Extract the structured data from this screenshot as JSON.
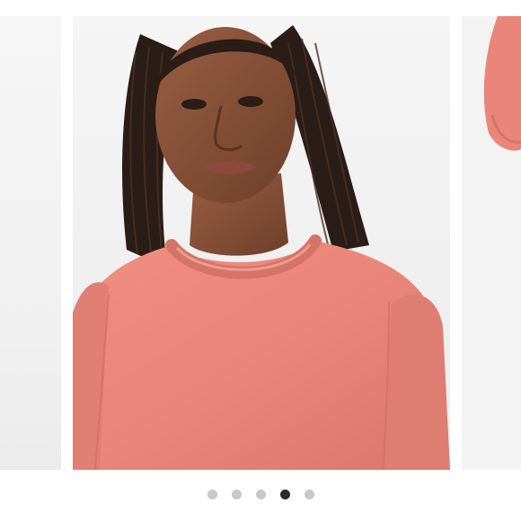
{
  "carousel": {
    "slide_count": 5,
    "active_index": 3,
    "slides": [
      {
        "state": "previous",
        "subject": "product-photo"
      },
      {
        "state": "current",
        "subject": "model-wearing-pink-crew-sweatshirt"
      },
      {
        "state": "next",
        "subject": "sweatshirt-sleeve"
      }
    ],
    "product_color": "#e98579",
    "background_color": "#f3f3f3"
  },
  "pagination": {
    "dots": [
      {
        "index": 1,
        "active": false
      },
      {
        "index": 2,
        "active": false
      },
      {
        "index": 3,
        "active": false
      },
      {
        "index": 4,
        "active": true
      },
      {
        "index": 5,
        "active": false
      }
    ],
    "active_color": "#2b2b2b",
    "inactive_color": "#c8c8c8"
  }
}
